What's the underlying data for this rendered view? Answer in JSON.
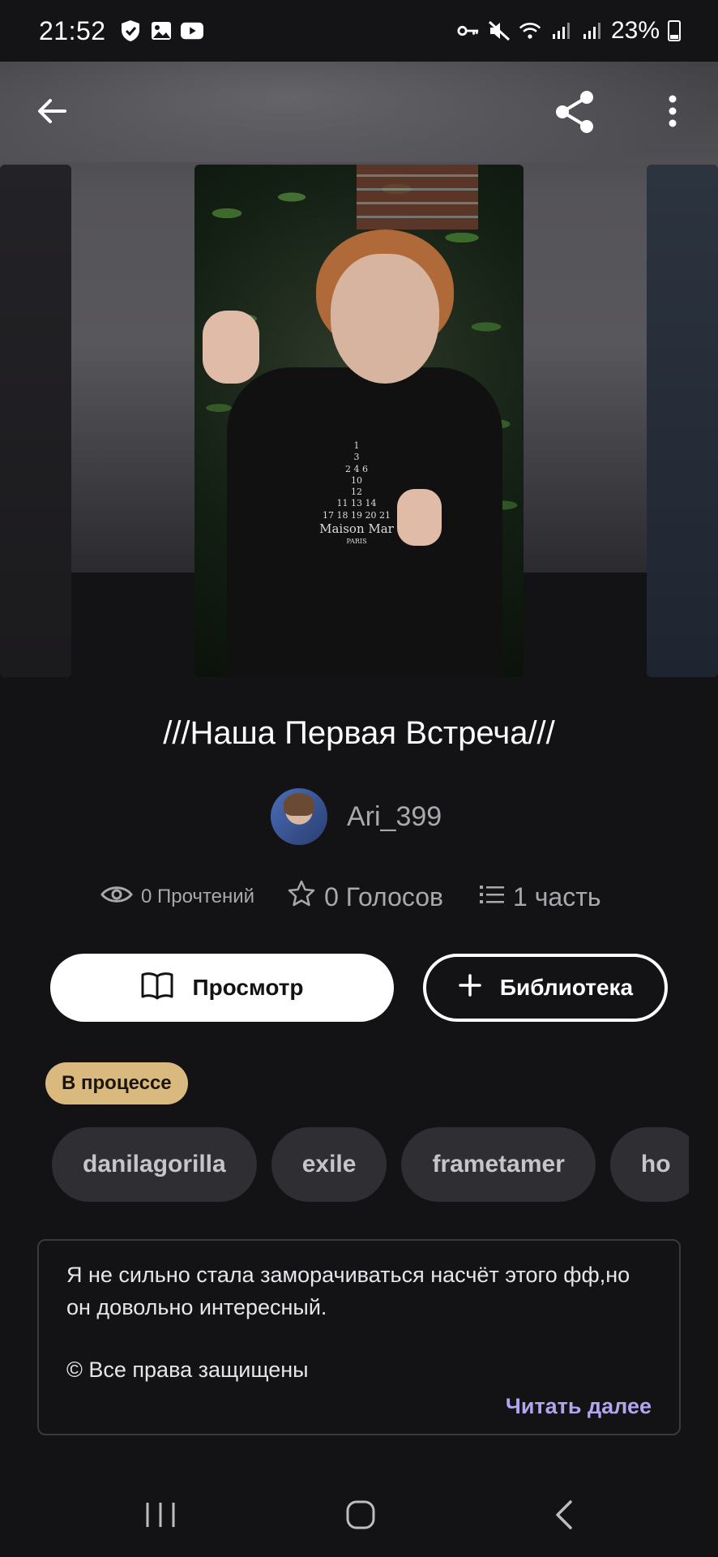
{
  "status_bar": {
    "time": "21:52",
    "battery": "23%",
    "left_icons": [
      "shield-icon",
      "gallery-icon",
      "youtube-icon"
    ],
    "right_icons": [
      "key-icon",
      "mute-icon",
      "wifi-icon",
      "signal-icon",
      "signal-icon",
      "battery-icon"
    ]
  },
  "app_bar": {
    "icons": [
      "back-arrow-icon",
      "share-icon",
      "more-vert-icon"
    ]
  },
  "cover": {
    "shirt_print_lines": [
      "1",
      "3",
      "2 4 6",
      "10",
      "12",
      "11 13 14",
      "17 18 19 20 21",
      "Maison Mar",
      "PARIS"
    ]
  },
  "story": {
    "title": "///Наша Первая Встреча///",
    "author": "Ari_399",
    "reads": "0 Прочтений",
    "votes": "0 Голосов",
    "parts": "1 часть"
  },
  "actions": {
    "read_label": "Просмотр",
    "library_label": "Библиотека"
  },
  "status_badge": "В процессе",
  "tags": [
    "danilagorilla",
    "exile",
    "frametamer",
    "ho"
  ],
  "description": {
    "text": "Я не сильно стала заморачиваться насчёт этого фф,но он довольно интересный.",
    "copyright": "© Все права защищены",
    "read_more": "Читать далее"
  },
  "nav_bar": {
    "icons": [
      "recents-icon",
      "home-icon",
      "back-icon"
    ]
  },
  "colors": {
    "background": "#131215",
    "badge": "#d9b97e",
    "tag_bg": "#2f2e33",
    "read_more": "#b3a4ee",
    "muted_text": "#a9a8ad"
  }
}
